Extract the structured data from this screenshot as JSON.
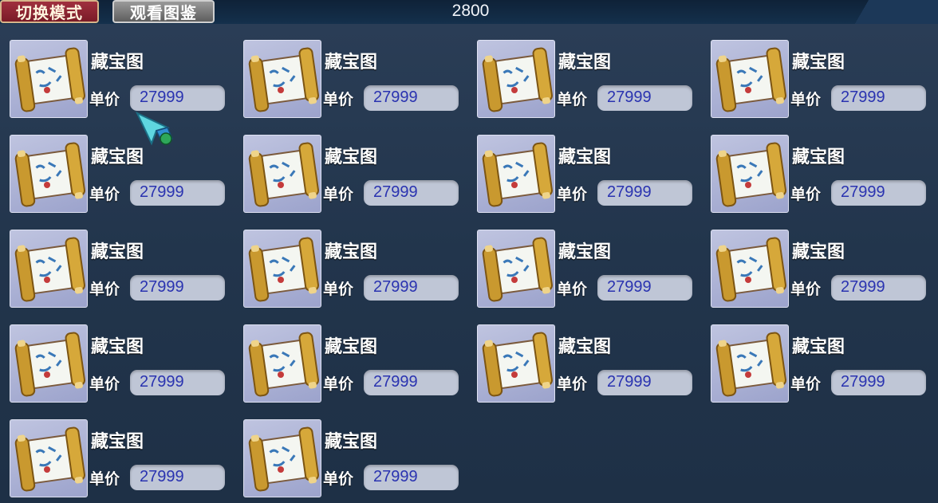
{
  "header": {
    "mode_button": "切换模式",
    "guide_button": "观看图鉴",
    "value": "2800"
  },
  "items": [
    {
      "name": "藏宝图",
      "price_label": "单价",
      "price": "27999"
    },
    {
      "name": "藏宝图",
      "price_label": "单价",
      "price": "27999"
    },
    {
      "name": "藏宝图",
      "price_label": "单价",
      "price": "27999"
    },
    {
      "name": "藏宝图",
      "price_label": "单价",
      "price": "27999"
    },
    {
      "name": "藏宝图",
      "price_label": "单价",
      "price": "27999"
    },
    {
      "name": "藏宝图",
      "price_label": "单价",
      "price": "27999"
    },
    {
      "name": "藏宝图",
      "price_label": "单价",
      "price": "27999"
    },
    {
      "name": "藏宝图",
      "price_label": "单价",
      "price": "27999"
    },
    {
      "name": "藏宝图",
      "price_label": "单价",
      "price": "27999"
    },
    {
      "name": "藏宝图",
      "price_label": "单价",
      "price": "27999"
    },
    {
      "name": "藏宝图",
      "price_label": "单价",
      "price": "27999"
    },
    {
      "name": "藏宝图",
      "price_label": "单价",
      "price": "27999"
    },
    {
      "name": "藏宝图",
      "price_label": "单价",
      "price": "27999"
    },
    {
      "name": "藏宝图",
      "price_label": "单价",
      "price": "27999"
    },
    {
      "name": "藏宝图",
      "price_label": "单价",
      "price": "27999"
    },
    {
      "name": "藏宝图",
      "price_label": "单价",
      "price": "27999"
    },
    {
      "name": "藏宝图",
      "price_label": "单价",
      "price": "27999"
    },
    {
      "name": "藏宝图",
      "price_label": "单价",
      "price": "27999"
    }
  ],
  "icons": {
    "item_icon": "treasure-map-scroll-icon",
    "cursor": "arrow-cursor-icon"
  },
  "colors": {
    "mode_button": "#8f2533",
    "price_text": "#2a33b0",
    "card_icon_bg": "#b3b9dc"
  }
}
